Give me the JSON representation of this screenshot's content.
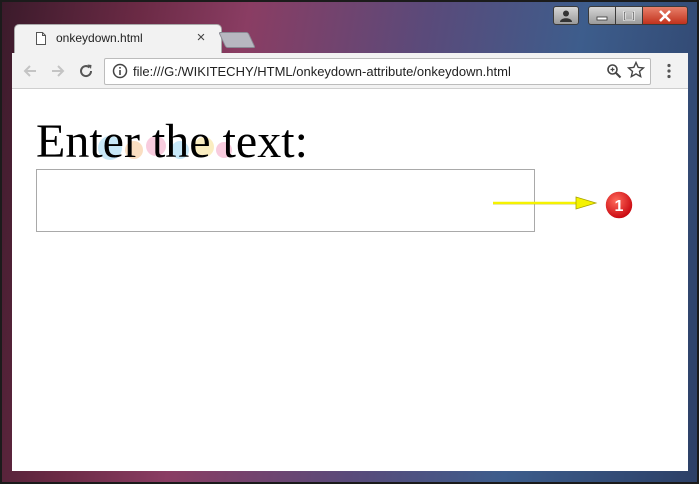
{
  "window": {
    "controls": {
      "user": "user-icon",
      "minimize": "minimize-icon",
      "maximize": "maximize-icon",
      "close": "close-icon"
    }
  },
  "tab": {
    "title": "onkeydown.html",
    "close_label": "×"
  },
  "toolbar": {
    "url": "file:///G:/WIKITECHY/HTML/onkeydown-attribute/onkeydown.html"
  },
  "page": {
    "label": "Enter the text:",
    "input_value": ""
  },
  "annotation": {
    "badge_number": "1",
    "arrow_color": "#f5f200",
    "badge_color": "#e0121a"
  }
}
